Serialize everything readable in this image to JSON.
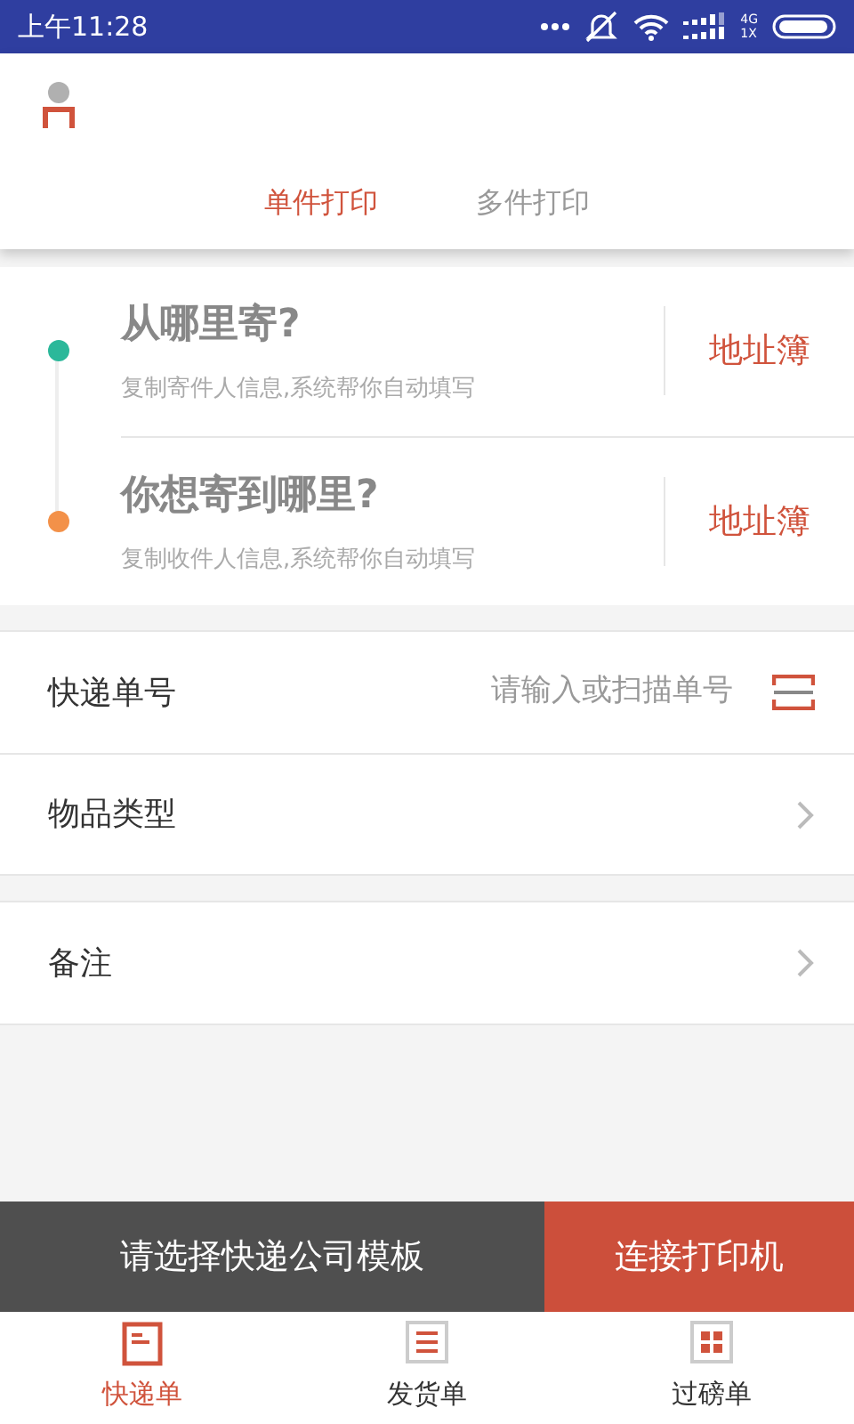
{
  "status_bar": {
    "time": "上午11:28",
    "network": [
      "4G",
      "1X"
    ]
  },
  "tabs": [
    {
      "label": "单件打印",
      "selected": true
    },
    {
      "label": "多件打印",
      "selected": false
    }
  ],
  "addresses": [
    {
      "title": "从哪里寄?",
      "hint": "复制寄件人信息,系统帮你自动填写",
      "link": "地址簿",
      "color": "#2bb89a"
    },
    {
      "title": "你想寄到哪里?",
      "hint": "复制收件人信息,系统帮你自动填写",
      "link": "地址簿",
      "color": "#f39149"
    }
  ],
  "form_groups": [
    [
      {
        "kind": "input",
        "label": "快递单号",
        "placeholder": "请输入或扫描单号"
      },
      {
        "kind": "select",
        "label": "物品类型"
      }
    ],
    [
      {
        "kind": "select",
        "label": "备注"
      }
    ]
  ],
  "actions": [
    {
      "label": "请选择快递公司模板",
      "kind": "secondary"
    },
    {
      "label": "连接打印机",
      "kind": "primary"
    }
  ],
  "bottom_nav": [
    {
      "label": "快递单",
      "kind": "doc",
      "selected": true
    },
    {
      "label": "发货单",
      "kind": "list",
      "selected": false
    },
    {
      "label": "过磅单",
      "kind": "grid",
      "selected": false
    }
  ]
}
